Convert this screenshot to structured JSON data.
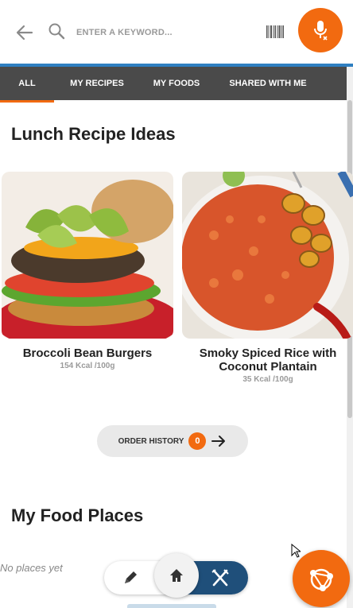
{
  "search": {
    "placeholder": "ENTER A KEYWORD..."
  },
  "tabs": [
    {
      "label": "ALL",
      "active": true
    },
    {
      "label": "MY RECIPES",
      "active": false
    },
    {
      "label": "MY FOODS",
      "active": false
    },
    {
      "label": "SHARED WITH ME",
      "active": false
    }
  ],
  "lunch": {
    "title": "Lunch Recipe Ideas",
    "recipes": [
      {
        "name": "Broccoli Bean Burgers",
        "kcal": "154 Kcal /100g"
      },
      {
        "name": "Smoky Spiced Rice with Coconut Plantain",
        "kcal": "35 Kcal /100g"
      }
    ]
  },
  "order_history": {
    "label": "ORDER HISTORY",
    "count": "0"
  },
  "food_places": {
    "title": "My Food Places",
    "empty_text": "No places yet"
  },
  "icons": {
    "back": "arrow-left-icon",
    "search": "search-icon",
    "barcode": "barcode-icon",
    "mic": "microphone-icon",
    "pencil": "pencil-icon",
    "home": "home-icon",
    "cutlery": "fork-knife-icon",
    "fab": "share-network-icon"
  },
  "colors": {
    "accent": "#f26a10",
    "tabbar": "#4a4a4a",
    "nav_blue": "#1f4f7a",
    "line_blue": "#2f7fc1"
  }
}
